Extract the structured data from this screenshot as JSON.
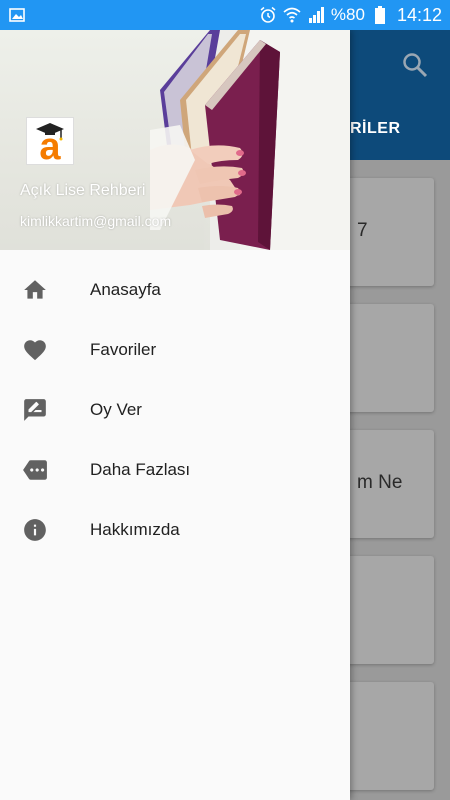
{
  "status_bar": {
    "battery": "%80",
    "time": "14:12",
    "icons": [
      "gallery-icon",
      "alarm-icon",
      "wifi-icon",
      "signal-icon",
      "battery-icon"
    ]
  },
  "drawer": {
    "app_name": "Açık Lise Rehberi",
    "email": "kimlikkartim@gmail.com",
    "logo_letter": "a",
    "items": [
      {
        "label": "Anasayfa",
        "icon": "home-icon"
      },
      {
        "label": "Favoriler",
        "icon": "heart-icon"
      },
      {
        "label": "Oy Ver",
        "icon": "rate-review-icon"
      },
      {
        "label": "Daha Fazlası",
        "icon": "more-label-icon"
      },
      {
        "label": "Hakkımızda",
        "icon": "info-icon"
      }
    ]
  },
  "background": {
    "tab_partial": "RİLER",
    "cards": [
      {
        "text": "7"
      },
      {
        "text": ""
      },
      {
        "text": "m Ne"
      },
      {
        "text": ""
      },
      {
        "text": ""
      }
    ]
  },
  "colors": {
    "status_bar": "#2196f3",
    "toolbar": "#0d4a7a",
    "drawer_bg": "#fafafa",
    "icon_gray": "#616161",
    "logo_orange": "#f57c00"
  }
}
